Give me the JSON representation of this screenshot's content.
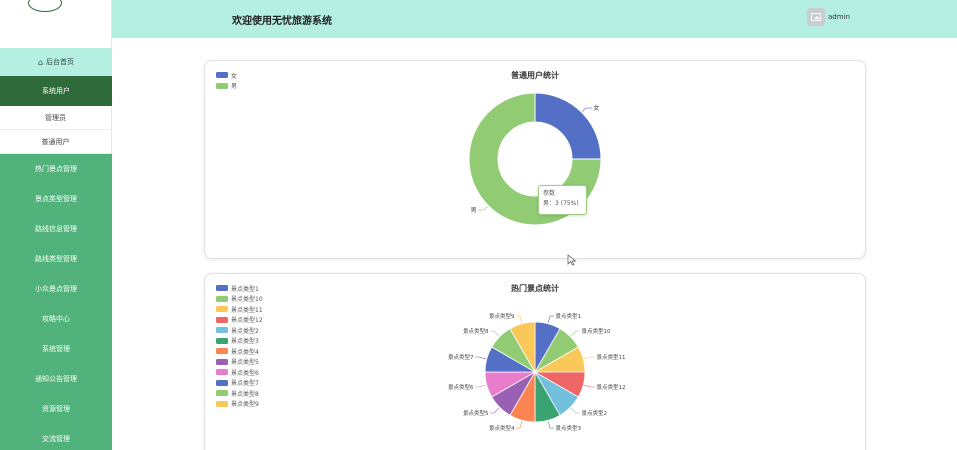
{
  "sidebar": {
    "home": {
      "label": "后台首页"
    },
    "sub_head": {
      "label": "系统用户"
    },
    "sub_items": [
      {
        "label": "管理员"
      },
      {
        "label": "普通用户"
      }
    ],
    "items": [
      {
        "label": "热门景点管理"
      },
      {
        "label": "景点类型管理"
      },
      {
        "label": "路线信息管理"
      },
      {
        "label": "路线类型管理"
      },
      {
        "label": "小众景点管理"
      },
      {
        "label": "攻略中心"
      },
      {
        "label": "系统管理"
      },
      {
        "label": "通知公告管理"
      },
      {
        "label": "资源管理"
      },
      {
        "label": "交流管理"
      }
    ]
  },
  "header": {
    "title": "欢迎使用无忧旅游系统",
    "username": "admin"
  },
  "colors": {
    "blue": "#5470c6",
    "green": "#91cc75"
  },
  "charts": {
    "users": {
      "title": "普通用户统计"
    },
    "spots": {
      "title": "热门景点统计"
    }
  },
  "tooltip": {
    "series": "参数",
    "value_text": "男：3 (75%)"
  },
  "chart_data": [
    {
      "type": "pie",
      "title": "普通用户统计",
      "donut": true,
      "legend": "top-left",
      "labels": [
        "女",
        "男"
      ],
      "values": [
        1,
        3
      ],
      "colors": [
        "#5470c6",
        "#91cc75"
      ]
    },
    {
      "type": "pie",
      "title": "热门景点统计",
      "legend": "top-left",
      "labels": [
        "景点类型1",
        "景点类型10",
        "景点类型11",
        "景点类型12",
        "景点类型2",
        "景点类型3",
        "景点类型4",
        "景点类型5",
        "景点类型6",
        "景点类型7",
        "景点类型8",
        "景点类型9"
      ],
      "values": [
        1,
        1,
        1,
        1,
        1,
        1,
        1,
        1,
        1,
        1,
        1,
        1
      ],
      "colors": [
        "#5470c6",
        "#91cc75",
        "#fac858",
        "#ee6666",
        "#73c0de",
        "#3ba272",
        "#fc8452",
        "#9a60b4",
        "#ea7ccc",
        "#5470c6",
        "#91cc75",
        "#fac858"
      ]
    }
  ]
}
